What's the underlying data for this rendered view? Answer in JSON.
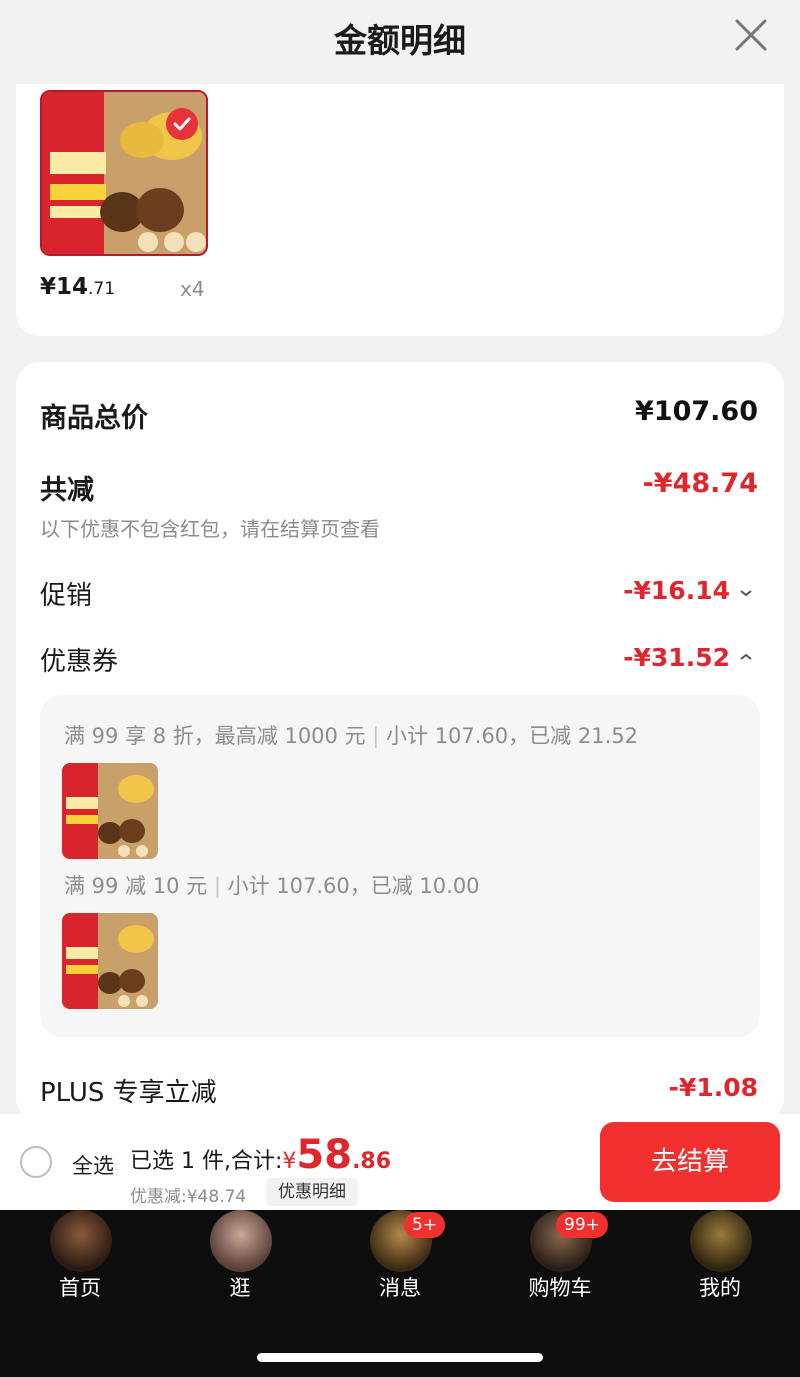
{
  "header": {
    "title": "金额明细"
  },
  "product": {
    "price_int": "¥14",
    "price_dec": ".71",
    "quantity": "x4"
  },
  "summary": {
    "goods_total_label": "商品总价",
    "goods_total_value": "¥107.60",
    "total_reduce_label": "共减",
    "total_reduce_value": "-¥48.74",
    "note": "以下优惠不包含红包，请在结算页查看",
    "promo_label": "促销",
    "promo_value": "-¥16.14",
    "coupon_label": "优惠券",
    "coupon_value": "-¥31.52",
    "plus_label": "PLUS 专享立减",
    "plus_value": "-¥1.08"
  },
  "coupons": [
    {
      "rule": "满 99 享 8 折，最高减 1000 元",
      "detail": "小计 107.60，已减 21.52"
    },
    {
      "rule": "满 99 减 10 元",
      "detail": "小计 107.60，已减 10.00"
    }
  ],
  "bottom_bar": {
    "select_all": "全选",
    "selected_text": "已选 1 件,合计:",
    "currency": "¥",
    "total_int": "58",
    "total_dec": ".86",
    "discount_text": "优惠减:¥48.74",
    "detail_link": "优惠明细",
    "checkout": "去结算"
  },
  "tabs": [
    {
      "label": "首页",
      "badge": ""
    },
    {
      "label": "逛",
      "badge": ""
    },
    {
      "label": "消息",
      "badge": "5+"
    },
    {
      "label": "购物车",
      "badge": "99+"
    },
    {
      "label": "我的",
      "badge": ""
    }
  ],
  "colors": {
    "accent_red": "#e0262d",
    "checkout_red": "#f23030",
    "tab_background": "#0d0d0d"
  }
}
